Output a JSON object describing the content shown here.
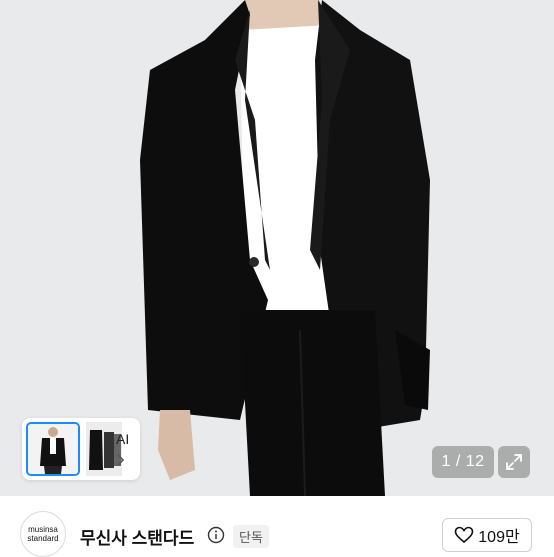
{
  "gallery": {
    "counter": "1 / 12",
    "ai_label": "AI"
  },
  "brand": {
    "logo_line1": "musinsa",
    "logo_line2": "standard",
    "name": "무신사 스탠다드",
    "badge": "단독"
  },
  "like": {
    "count": "109만"
  },
  "icons": [
    "chevron-right-icon",
    "expand-icon",
    "info-icon",
    "heart-icon"
  ]
}
